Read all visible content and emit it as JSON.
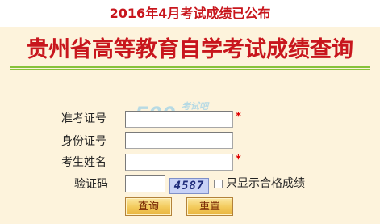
{
  "notice": {
    "headline": "2016年4月考试成绩已公布"
  },
  "header": {
    "title": "贵州省高等教育自学考试成绩查询"
  },
  "watermark": {
    "number": "500",
    "site_cn": "考试吧",
    "domain": ".com"
  },
  "form": {
    "exam_id_label": "准考证号",
    "exam_id_value": "",
    "id_card_label": "身份证号",
    "id_card_value": "",
    "name_label": "考生姓名",
    "name_value": "",
    "captcha_label": "验证码",
    "captcha_value": "",
    "captcha_image_text": "4587",
    "required_mark": "*",
    "pass_only_label": "只显示合格成绩",
    "pass_only_checked": false
  },
  "buttons": {
    "query": "查询",
    "reset": "重置"
  },
  "colors": {
    "title_red": "#c8161d",
    "panel_bg": "#fdf3dc",
    "rule_green": "#86c23a",
    "button_gold": "#f2c95a"
  }
}
